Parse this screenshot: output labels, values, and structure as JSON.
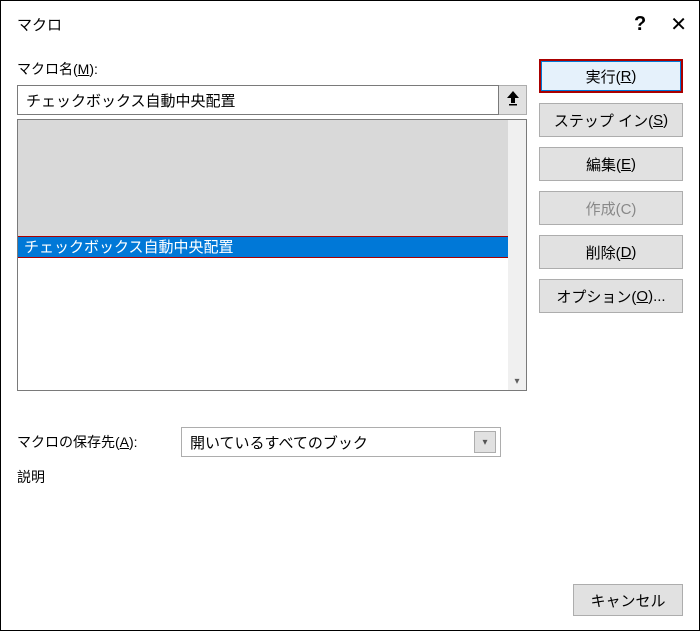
{
  "titlebar": {
    "title": "マクロ"
  },
  "labels": {
    "macroName_prefix": "マクロ名(",
    "macroName_u": "M",
    "macroName_suffix": "):",
    "storage_prefix": "マクロの保存先(",
    "storage_u": "A",
    "storage_suffix": "):",
    "description": "説明"
  },
  "macroName": {
    "value": "チェックボックス自動中央配置"
  },
  "list": {
    "selected": "チェックボックス自動中央配置"
  },
  "storage": {
    "selected": "開いているすべてのブック"
  },
  "buttons": {
    "run_prefix": "実行(",
    "run_u": "R",
    "run_suffix": ")",
    "stepIn_prefix": "ステップ イン(",
    "stepIn_u": "S",
    "stepIn_suffix": ")",
    "edit_prefix": "編集(",
    "edit_u": "E",
    "edit_suffix": ")",
    "create_full": "作成(C)",
    "delete_prefix": "削除(",
    "delete_u": "D",
    "delete_suffix": ")",
    "options_prefix": "オプション(",
    "options_u": "O",
    "options_suffix": ")...",
    "cancel": "キャンセル"
  }
}
